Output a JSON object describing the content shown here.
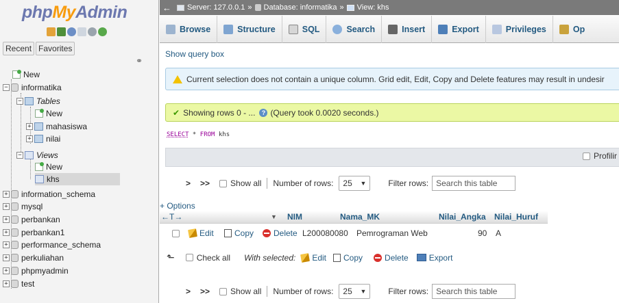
{
  "logo": {
    "php": "php",
    "my": "My",
    "admin": "Admin"
  },
  "nav": {
    "tabs": [
      "Recent",
      "Favorites"
    ],
    "tree": [
      {
        "label": "New",
        "kind": "new",
        "depth": 0
      },
      {
        "label": "informatika",
        "kind": "db",
        "depth": 0,
        "expanded": true
      },
      {
        "label": "Tables",
        "kind": "folder",
        "depth": 1,
        "expanded": true
      },
      {
        "label": "New",
        "kind": "new",
        "depth": 2
      },
      {
        "label": "mahasiswa",
        "kind": "table",
        "depth": 2
      },
      {
        "label": "nilai",
        "kind": "table",
        "depth": 2
      },
      {
        "label": "Views",
        "kind": "folder",
        "depth": 1,
        "expanded": true
      },
      {
        "label": "New",
        "kind": "new",
        "depth": 2
      },
      {
        "label": "khs",
        "kind": "view",
        "depth": 2,
        "selected": true
      },
      {
        "label": "information_schema",
        "kind": "db",
        "depth": 0
      },
      {
        "label": "mysql",
        "kind": "db",
        "depth": 0
      },
      {
        "label": "perbankan",
        "kind": "db",
        "depth": 0
      },
      {
        "label": "perbankan1",
        "kind": "db",
        "depth": 0
      },
      {
        "label": "performance_schema",
        "kind": "db",
        "depth": 0
      },
      {
        "label": "perkuliahan",
        "kind": "db",
        "depth": 0
      },
      {
        "label": "phpmyadmin",
        "kind": "db",
        "depth": 0
      },
      {
        "label": "test",
        "kind": "db",
        "depth": 0
      }
    ]
  },
  "breadcrumb": {
    "server": "Server: 127.0.0.1",
    "database": "Database: informatika",
    "view": "View: khs"
  },
  "tabs": [
    {
      "label": "Browse",
      "icon": "browse-icon",
      "color": "#9db4cf"
    },
    {
      "label": "Structure",
      "icon": "structure-icon",
      "color": "#7fa5d1"
    },
    {
      "label": "SQL",
      "icon": "sql-icon",
      "color": "#d6d6d6"
    },
    {
      "label": "Search",
      "icon": "search-icon",
      "color": "#8ab0dc"
    },
    {
      "label": "Insert",
      "icon": "insert-icon",
      "color": "#666666"
    },
    {
      "label": "Export",
      "icon": "export-icon",
      "color": "#4e7fb8"
    },
    {
      "label": "Privileges",
      "icon": "privileges-icon",
      "color": "#b8c7e0"
    },
    {
      "label": "Op",
      "icon": "wrench-icon",
      "color": "#c9a23c"
    }
  ],
  "main": {
    "show_query": "Show query box",
    "notice": "Current selection does not contain a unique column. Grid edit, Edit, Copy and Delete features may result in undesir",
    "success_prefix": "Showing rows 0 - ...",
    "success_suffix": "(Query took 0.0020 seconds.)",
    "sql_select": "SELECT",
    "sql_star": " * ",
    "sql_from": "FROM",
    "sql_table": " khs",
    "profiling": "Profilir",
    "pager": {
      "first": ">",
      "last": ">>",
      "show_all": "Show all",
      "rows_label": "Number of rows:",
      "rows_value": "25",
      "filter_label": "Filter rows:",
      "filter_placeholder": "Search this table"
    },
    "options": "+ Options",
    "columns": [
      "NIM",
      "Nama_MK",
      "Nilai_Angka",
      "Nilai_Huruf"
    ],
    "rows": [
      {
        "NIM": "L200080080",
        "Nama_MK": "Pemrograman Web",
        "Nilai_Angka": "90",
        "Nilai_Huruf": "A"
      }
    ],
    "row_actions": {
      "edit": "Edit",
      "copy": "Copy",
      "delete": "Delete"
    },
    "with_selected": {
      "check_all": "Check all",
      "label": "With selected:",
      "edit": "Edit",
      "copy": "Copy",
      "delete": "Delete",
      "export": "Export"
    }
  }
}
